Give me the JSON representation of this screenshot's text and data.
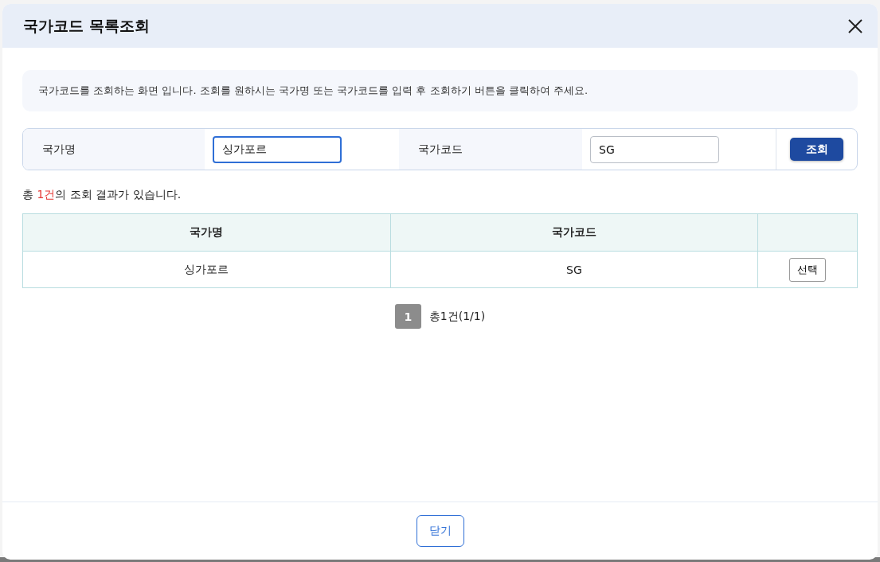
{
  "dialog": {
    "title": "국가코드 목록조회"
  },
  "notice": "국가코드를 조회하는 화면 입니다. 조회를 원하시는 국가명 또는 국가코드를 입력 후 조회하기 버튼을 클릭하여 주세요.",
  "search": {
    "fields": [
      {
        "label": "국가명",
        "value": "싱가포르",
        "focused": true
      },
      {
        "label": "국가코드",
        "value": "SG",
        "focused": false
      }
    ],
    "button": "조회"
  },
  "summary": {
    "prefix": "총 ",
    "count": "1건",
    "suffix": "의 조회 결과가 있습니다."
  },
  "table": {
    "columns": [
      "국가명",
      "국가코드"
    ],
    "rows": [
      {
        "cells": [
          "싱가포르",
          "SG"
        ],
        "action": "선택"
      }
    ]
  },
  "pagination": {
    "pages": [
      {
        "label": "1",
        "selected": true
      }
    ],
    "total": "총1건(1/1)"
  },
  "footer": {
    "button": "닫기"
  }
}
